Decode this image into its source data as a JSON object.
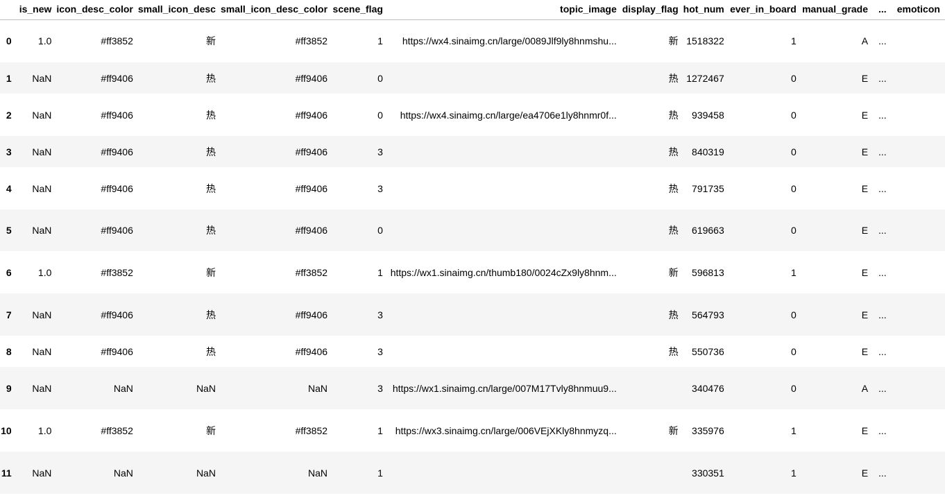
{
  "table": {
    "columns": [
      "is_new",
      "icon_desc_color",
      "small_icon_desc",
      "small_icon_desc_color",
      "scene_flag",
      "topic_image",
      "display_flag",
      "hot_num",
      "ever_in_board",
      "manual_grade",
      "...",
      "emoticon"
    ],
    "rows": [
      {
        "idx": "0",
        "is_new": "1.0",
        "icon_desc_color": "#ff3852",
        "small_icon_desc": "新",
        "small_icon_desc_color": "#ff3852",
        "scene_flag": "1",
        "topic_image": "https://wx4.sinaimg.cn/large/0089Jlf9ly8hnmshu...",
        "display_flag": "新",
        "hot_num": "1518322",
        "ever_in_board": "1",
        "manual_grade": "A",
        "ellipsis": "..."
      },
      {
        "idx": "1",
        "is_new": "NaN",
        "icon_desc_color": "#ff9406",
        "small_icon_desc": "热",
        "small_icon_desc_color": "#ff9406",
        "scene_flag": "0",
        "topic_image": "",
        "display_flag": "热",
        "hot_num": "1272467",
        "ever_in_board": "0",
        "manual_grade": "E",
        "ellipsis": "..."
      },
      {
        "idx": "2",
        "is_new": "NaN",
        "icon_desc_color": "#ff9406",
        "small_icon_desc": "热",
        "small_icon_desc_color": "#ff9406",
        "scene_flag": "0",
        "topic_image": "https://wx4.sinaimg.cn/large/ea4706e1ly8hnmr0f...",
        "display_flag": "热",
        "hot_num": "939458",
        "ever_in_board": "0",
        "manual_grade": "E",
        "ellipsis": "..."
      },
      {
        "idx": "3",
        "is_new": "NaN",
        "icon_desc_color": "#ff9406",
        "small_icon_desc": "热",
        "small_icon_desc_color": "#ff9406",
        "scene_flag": "3",
        "topic_image": "",
        "display_flag": "热",
        "hot_num": "840319",
        "ever_in_board": "0",
        "manual_grade": "E",
        "ellipsis": "..."
      },
      {
        "idx": "4",
        "is_new": "NaN",
        "icon_desc_color": "#ff9406",
        "small_icon_desc": "热",
        "small_icon_desc_color": "#ff9406",
        "scene_flag": "3",
        "topic_image": "",
        "display_flag": "热",
        "hot_num": "791735",
        "ever_in_board": "0",
        "manual_grade": "E",
        "ellipsis": "..."
      },
      {
        "idx": "5",
        "is_new": "NaN",
        "icon_desc_color": "#ff9406",
        "small_icon_desc": "热",
        "small_icon_desc_color": "#ff9406",
        "scene_flag": "0",
        "topic_image": "",
        "display_flag": "热",
        "hot_num": "619663",
        "ever_in_board": "0",
        "manual_grade": "E",
        "ellipsis": "..."
      },
      {
        "idx": "6",
        "is_new": "1.0",
        "icon_desc_color": "#ff3852",
        "small_icon_desc": "新",
        "small_icon_desc_color": "#ff3852",
        "scene_flag": "1",
        "topic_image": "https://wx1.sinaimg.cn/thumb180/0024cZx9ly8hnm...",
        "display_flag": "新",
        "hot_num": "596813",
        "ever_in_board": "1",
        "manual_grade": "E",
        "ellipsis": "..."
      },
      {
        "idx": "7",
        "is_new": "NaN",
        "icon_desc_color": "#ff9406",
        "small_icon_desc": "热",
        "small_icon_desc_color": "#ff9406",
        "scene_flag": "3",
        "topic_image": "",
        "display_flag": "热",
        "hot_num": "564793",
        "ever_in_board": "0",
        "manual_grade": "E",
        "ellipsis": "..."
      },
      {
        "idx": "8",
        "is_new": "NaN",
        "icon_desc_color": "#ff9406",
        "small_icon_desc": "热",
        "small_icon_desc_color": "#ff9406",
        "scene_flag": "3",
        "topic_image": "",
        "display_flag": "热",
        "hot_num": "550736",
        "ever_in_board": "0",
        "manual_grade": "E",
        "ellipsis": "..."
      },
      {
        "idx": "9",
        "is_new": "NaN",
        "icon_desc_color": "NaN",
        "small_icon_desc": "NaN",
        "small_icon_desc_color": "NaN",
        "scene_flag": "3",
        "topic_image": "https://wx1.sinaimg.cn/large/007M17Tvly8hnmuu9...",
        "display_flag": "",
        "hot_num": "340476",
        "ever_in_board": "0",
        "manual_grade": "A",
        "ellipsis": "..."
      },
      {
        "idx": "10",
        "is_new": "1.0",
        "icon_desc_color": "#ff3852",
        "small_icon_desc": "新",
        "small_icon_desc_color": "#ff3852",
        "scene_flag": "1",
        "topic_image": "https://wx3.sinaimg.cn/large/006VEjXKly8hnmyzq...",
        "display_flag": "新",
        "hot_num": "335976",
        "ever_in_board": "1",
        "manual_grade": "E",
        "ellipsis": "..."
      },
      {
        "idx": "11",
        "is_new": "NaN",
        "icon_desc_color": "NaN",
        "small_icon_desc": "NaN",
        "small_icon_desc_color": "NaN",
        "scene_flag": "1",
        "topic_image": "",
        "display_flag": "",
        "hot_num": "330351",
        "ever_in_board": "1",
        "manual_grade": "E",
        "ellipsis": "..."
      }
    ]
  }
}
